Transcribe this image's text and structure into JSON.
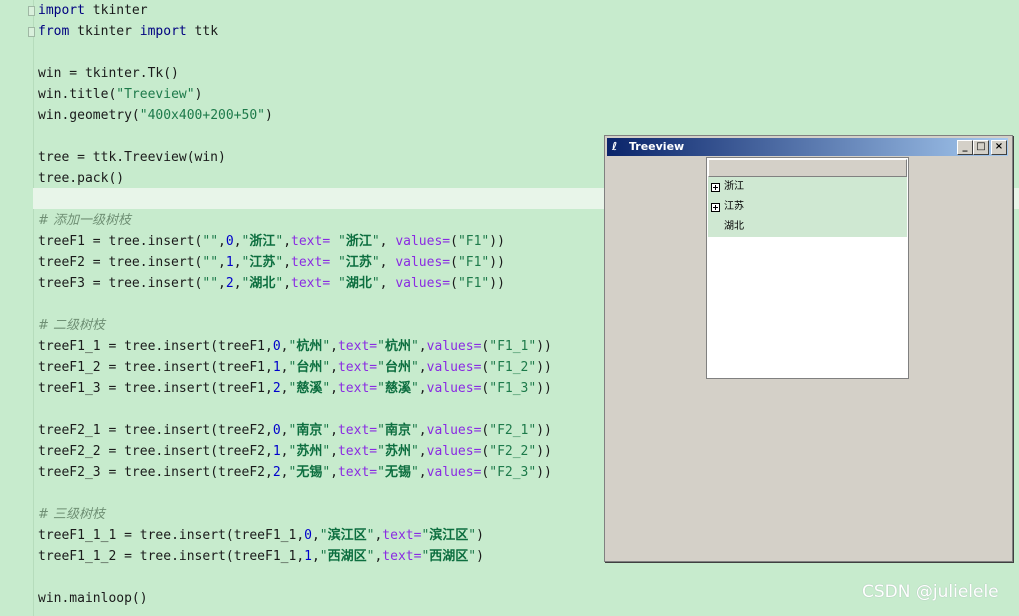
{
  "editor": {
    "line1": {
      "kw1": "import",
      "rest": " tkinter"
    },
    "line2": {
      "kw1": "from",
      "a": " tkinter ",
      "kw2": "import",
      "b": " ttk"
    },
    "line4": {
      "a": "win = tkinter.Tk()"
    },
    "line5": {
      "a": "win.title(",
      "s": "\"Treeview\"",
      "b": ")"
    },
    "line6": {
      "a": "win.geometry(",
      "s": "\"400x400+200+50\"",
      "b": ")"
    },
    "line8": {
      "a": "tree = ttk.Treeview(win)"
    },
    "line9": {
      "a": "tree.pack()"
    },
    "c1": "# 添加一级树枝",
    "c2": "# 二级树枝",
    "c3": "# 三级树枝",
    "last": "win.mainloop()"
  },
  "lvl1": [
    {
      "var": "treeF1",
      "idx": "0",
      "cn": "浙江",
      "val": "\"F1\""
    },
    {
      "var": "treeF2",
      "idx": "1",
      "cn": "江苏",
      "val": "\"F1\""
    },
    {
      "var": "treeF3",
      "idx": "2",
      "cn": "湖北",
      "val": "\"F1\""
    }
  ],
  "lvl2a": [
    {
      "var": "treeF1_1",
      "parent": "treeF1",
      "idx": "0",
      "cn": "杭州",
      "val": "\"F1_1\""
    },
    {
      "var": "treeF1_2",
      "parent": "treeF1",
      "idx": "1",
      "cn": "台州",
      "val": "\"F1_2\""
    },
    {
      "var": "treeF1_3",
      "parent": "treeF1",
      "idx": "2",
      "cn": "慈溪",
      "val": "\"F1_3\""
    }
  ],
  "lvl2b": [
    {
      "var": "treeF2_1",
      "parent": "treeF2",
      "idx": "0",
      "cn": "南京",
      "val": "\"F2_1\""
    },
    {
      "var": "treeF2_2",
      "parent": "treeF2",
      "idx": "1",
      "cn": "苏州",
      "val": "\"F2_2\""
    },
    {
      "var": "treeF2_3",
      "parent": "treeF2",
      "idx": "2",
      "cn": "无锡",
      "val": "\"F2_3\""
    }
  ],
  "lvl3": [
    {
      "var": "treeF1_1_1",
      "parent": "treeF1_1",
      "idx": "0",
      "cn": "滨江区"
    },
    {
      "var": "treeF1_1_2",
      "parent": "treeF1_1",
      "idx": "1",
      "cn": "西湖区"
    }
  ],
  "window": {
    "title": "Treeview",
    "icon": "feather-icon",
    "min": "_",
    "max": "□",
    "close": "×",
    "items": [
      {
        "label": "浙江",
        "expandable": true
      },
      {
        "label": "江苏",
        "expandable": true
      },
      {
        "label": "湖北",
        "expandable": false
      }
    ]
  },
  "watermark": "CSDN @julielele",
  "colors": {
    "background": "#c7ebcd",
    "keyword": "#000080",
    "string": "#1d7a4a",
    "title_start": "#0a246a",
    "title_end": "#a6caf0"
  }
}
